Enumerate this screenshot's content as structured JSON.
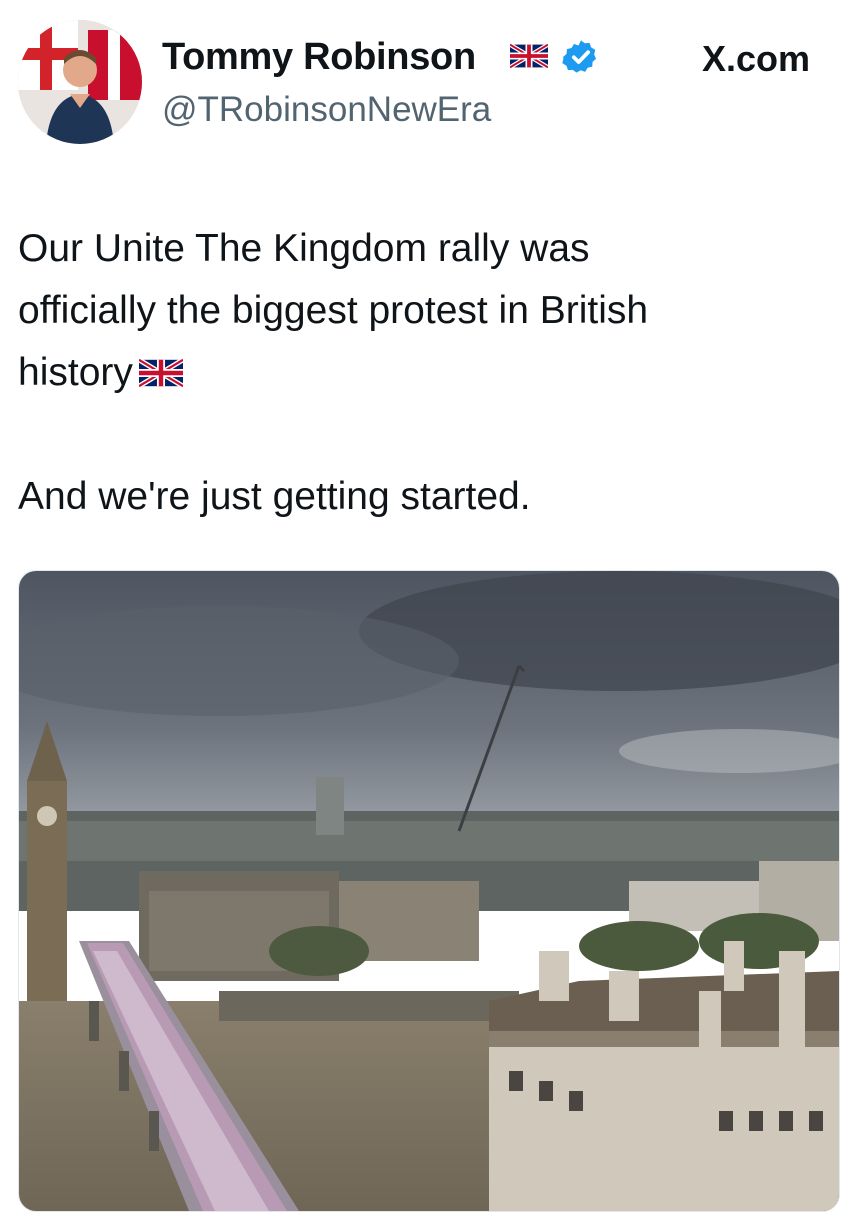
{
  "header": {
    "display_name": "Tommy Robinson",
    "handle": "@TRobinsonNewEra",
    "source": "X.com"
  },
  "tweet": {
    "line1": "Our Unite The Kingdom rally was",
    "line2": "officially the biggest protest in British",
    "line3": "history",
    "line4": "And we're just getting started."
  },
  "icons": {
    "flag": "uk-flag-icon",
    "verified": "verified-badge-icon"
  },
  "colors": {
    "verified": "#1d9bf0",
    "handle": "#536471",
    "text": "#0f1419"
  }
}
